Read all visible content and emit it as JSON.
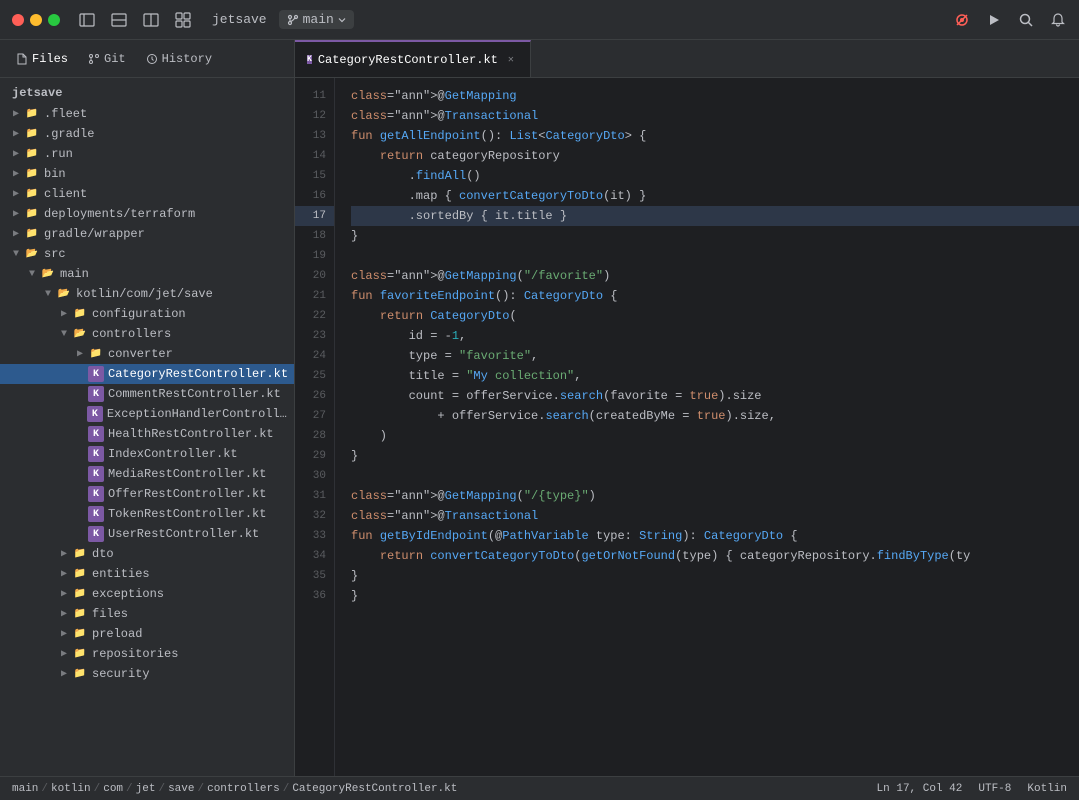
{
  "titlebar": {
    "project": "jetsave",
    "branch": "main",
    "traffic": [
      "red",
      "yellow",
      "green"
    ],
    "icons": [
      "sidebar-toggle",
      "layout-toggle",
      "layout-alt",
      "grid"
    ],
    "right_icons": [
      "recording",
      "run",
      "search",
      "bell"
    ]
  },
  "sidebar": {
    "tabs": [
      {
        "label": "Files",
        "icon": "files"
      },
      {
        "label": "Git",
        "icon": "git"
      },
      {
        "label": "History",
        "icon": "history"
      }
    ],
    "root": "jetsave",
    "tree": [
      {
        "id": "fleet",
        "label": ".fleet",
        "indent": 0,
        "type": "folder",
        "collapsed": true
      },
      {
        "id": "gradle",
        "label": ".gradle",
        "indent": 0,
        "type": "folder",
        "collapsed": true
      },
      {
        "id": "run",
        "label": ".run",
        "indent": 0,
        "type": "folder",
        "collapsed": true
      },
      {
        "id": "bin",
        "label": "bin",
        "indent": 0,
        "type": "folder",
        "collapsed": true
      },
      {
        "id": "client",
        "label": "client",
        "indent": 0,
        "type": "folder",
        "collapsed": true
      },
      {
        "id": "deployments",
        "label": "deployments/terraform",
        "indent": 0,
        "type": "folder",
        "collapsed": true
      },
      {
        "id": "gradle-wrapper",
        "label": "gradle/wrapper",
        "indent": 0,
        "type": "folder",
        "collapsed": true
      },
      {
        "id": "src",
        "label": "src",
        "indent": 0,
        "type": "folder",
        "collapsed": false
      },
      {
        "id": "main",
        "label": "main",
        "indent": 1,
        "type": "folder",
        "collapsed": false
      },
      {
        "id": "kotlin-com",
        "label": "kotlin/com/jet/save",
        "indent": 2,
        "type": "folder",
        "collapsed": false
      },
      {
        "id": "configuration",
        "label": "configuration",
        "indent": 3,
        "type": "folder",
        "collapsed": true
      },
      {
        "id": "controllers",
        "label": "controllers",
        "indent": 3,
        "type": "folder",
        "collapsed": false
      },
      {
        "id": "converter",
        "label": "converter",
        "indent": 4,
        "type": "folder",
        "collapsed": true
      },
      {
        "id": "CategoryRestController",
        "label": "CategoryRestController.kt",
        "indent": 4,
        "type": "kt",
        "selected": true
      },
      {
        "id": "CommentRestController",
        "label": "CommentRestController.kt",
        "indent": 4,
        "type": "kt"
      },
      {
        "id": "ExceptionHandlerController",
        "label": "ExceptionHandlerControlle...",
        "indent": 4,
        "type": "kt"
      },
      {
        "id": "HealthRestController",
        "label": "HealthRestController.kt",
        "indent": 4,
        "type": "kt"
      },
      {
        "id": "IndexController",
        "label": "IndexController.kt",
        "indent": 4,
        "type": "kt"
      },
      {
        "id": "MediaRestController",
        "label": "MediaRestController.kt",
        "indent": 4,
        "type": "kt"
      },
      {
        "id": "OfferRestController",
        "label": "OfferRestController.kt",
        "indent": 4,
        "type": "kt"
      },
      {
        "id": "TokenRestController",
        "label": "TokenRestController.kt",
        "indent": 4,
        "type": "kt"
      },
      {
        "id": "UserRestController",
        "label": "UserRestController.kt",
        "indent": 4,
        "type": "kt"
      },
      {
        "id": "dto",
        "label": "dto",
        "indent": 3,
        "type": "folder",
        "collapsed": true
      },
      {
        "id": "entities",
        "label": "entities",
        "indent": 3,
        "type": "folder",
        "collapsed": true
      },
      {
        "id": "exceptions",
        "label": "exceptions",
        "indent": 3,
        "type": "folder",
        "collapsed": true
      },
      {
        "id": "files",
        "label": "files",
        "indent": 3,
        "type": "folder",
        "collapsed": true
      },
      {
        "id": "preload",
        "label": "preload",
        "indent": 3,
        "type": "folder",
        "collapsed": true
      },
      {
        "id": "repositories",
        "label": "repositories",
        "indent": 3,
        "type": "folder",
        "collapsed": true
      },
      {
        "id": "security",
        "label": "security",
        "indent": 3,
        "type": "folder",
        "collapsed": true
      }
    ]
  },
  "editor": {
    "tabs": [
      {
        "label": "CategoryRestController.kt",
        "active": true,
        "icon": "kt"
      }
    ],
    "lines": [
      {
        "num": 11,
        "content": "@GetMapping",
        "type": "annotation"
      },
      {
        "num": 12,
        "content": "@Transactional",
        "type": "annotation"
      },
      {
        "num": 13,
        "content": "fun getAllEndpoint(): List<CategoryDto> {",
        "type": "code"
      },
      {
        "num": 14,
        "content": "    return categoryRepository",
        "type": "code"
      },
      {
        "num": 15,
        "content": "        .findAll()",
        "type": "code"
      },
      {
        "num": 16,
        "content": "        .map { convertCategoryToDto(it) }",
        "type": "code"
      },
      {
        "num": 17,
        "content": "        .sortedBy { it.title }",
        "type": "highlighted"
      },
      {
        "num": 18,
        "content": "}",
        "type": "code"
      },
      {
        "num": 19,
        "content": "",
        "type": "code"
      },
      {
        "num": 20,
        "content": "@GetMapping(\"/favorite\")",
        "type": "annotation-str"
      },
      {
        "num": 21,
        "content": "fun favoriteEndpoint(): CategoryDto {",
        "type": "code"
      },
      {
        "num": 22,
        "content": "    return CategoryDto(",
        "type": "code"
      },
      {
        "num": 23,
        "content": "        id = -1,",
        "type": "code"
      },
      {
        "num": 24,
        "content": "        type = \"favorite\",",
        "type": "code"
      },
      {
        "num": 25,
        "content": "        title = \"My collection\",",
        "type": "code"
      },
      {
        "num": 26,
        "content": "        count = offerService.search(favorite = true).size",
        "type": "code"
      },
      {
        "num": 27,
        "content": "            + offerService.search(createdByMe = true).size,",
        "type": "code"
      },
      {
        "num": 28,
        "content": "    )",
        "type": "code"
      },
      {
        "num": 29,
        "content": "}",
        "type": "code"
      },
      {
        "num": 30,
        "content": "",
        "type": "code"
      },
      {
        "num": 31,
        "content": "@GetMapping(\"/{type}\")",
        "type": "annotation-str"
      },
      {
        "num": 32,
        "content": "@Transactional",
        "type": "annotation"
      },
      {
        "num": 33,
        "content": "fun getByIdEndpoint(@PathVariable type: String): CategoryDto {",
        "type": "code"
      },
      {
        "num": 34,
        "content": "    return convertCategoryToDto(getOrNotFound(type) { categoryRepository.findByType(ty",
        "type": "code"
      },
      {
        "num": 35,
        "content": "}",
        "type": "code"
      },
      {
        "num": 36,
        "content": "}",
        "type": "code"
      }
    ]
  },
  "statusbar": {
    "breadcrumb": [
      "main",
      "kotlin",
      "com",
      "jet",
      "save",
      "controllers",
      "CategoryRestController.kt"
    ],
    "position": "Ln 17, Col 42",
    "encoding": "UTF-8",
    "file_type": "Kotlin"
  }
}
